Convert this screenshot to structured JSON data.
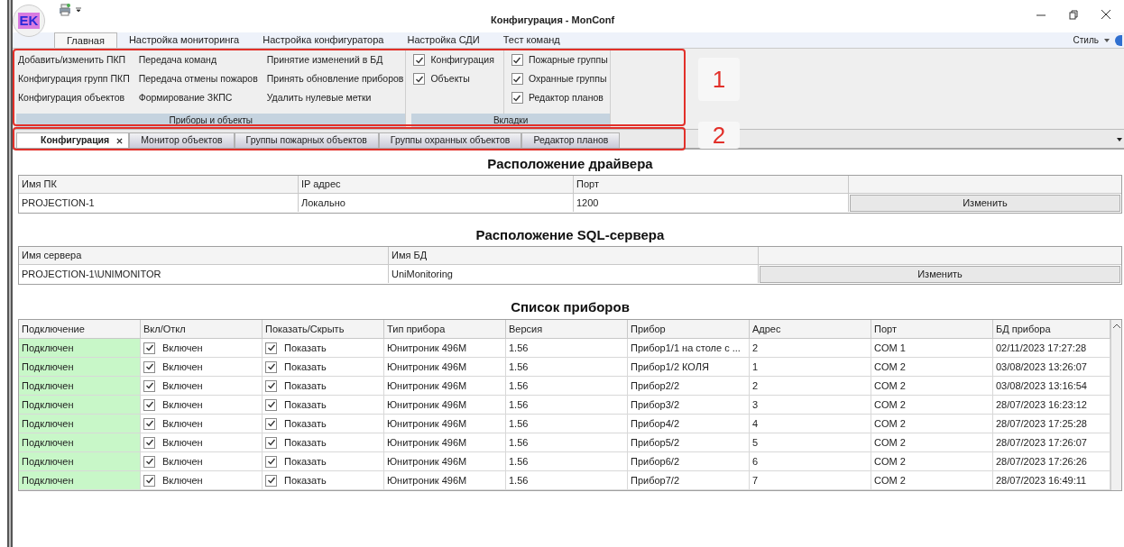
{
  "window": {
    "title": "Конфигурация - MonConf",
    "logo": "EK"
  },
  "ribbon_tabs": [
    {
      "label": "Главная",
      "selected": true
    },
    {
      "label": "Настройка мониторинга",
      "selected": false
    },
    {
      "label": "Настройка конфигуратора",
      "selected": false
    },
    {
      "label": "Настройка СДИ",
      "selected": false
    },
    {
      "label": "Тест команд",
      "selected": false
    }
  ],
  "style_menu": "Стиль",
  "ribbon_groups": [
    {
      "kind": "commands",
      "title": "Приборы и объекты",
      "columns": [
        [
          "Добавить/изменить ПКП",
          "Конфигурация групп ПКП",
          "Конфигурация объектов"
        ],
        [
          "Передача команд",
          "Передача отмены пожаров",
          "Формирование ЗКПС"
        ],
        [
          "Принятие изменений в БД",
          "Принять обновление приборов",
          "Удалить нулевые метки"
        ]
      ]
    },
    {
      "kind": "checks",
      "title": "Вкладки",
      "columns": [
        [
          {
            "label": "Конфигурация",
            "checked": true
          },
          {
            "label": "Объекты",
            "checked": true
          }
        ],
        [
          {
            "label": "Пожарные группы",
            "checked": true
          },
          {
            "label": "Охранные группы",
            "checked": true
          },
          {
            "label": "Редактор планов",
            "checked": true
          }
        ]
      ]
    }
  ],
  "doc_tabs": [
    {
      "label": "Конфигурация",
      "selected": true,
      "closable": true
    },
    {
      "label": "Монитор объектов",
      "selected": false,
      "closable": false
    },
    {
      "label": "Группы пожарных объектов",
      "selected": false,
      "closable": false
    },
    {
      "label": "Группы охранных объектов",
      "selected": false,
      "closable": false
    },
    {
      "label": "Редактор планов",
      "selected": false,
      "closable": false
    }
  ],
  "annotations": [
    {
      "label": "1"
    },
    {
      "label": "2"
    }
  ],
  "driver": {
    "title": "Расположение драйвера",
    "columns": [
      "Имя ПК",
      "IP адрес",
      "Порт"
    ],
    "row": [
      "PROJECTION-1",
      "Локально",
      "1200"
    ],
    "button": "Изменить"
  },
  "sql": {
    "title": "Расположение SQL-сервера",
    "columns": [
      "Имя сервера",
      "Имя БД"
    ],
    "row": [
      "PROJECTION-1\\UNIMONITOR",
      "UniMonitoring"
    ],
    "button": "Изменить"
  },
  "devices": {
    "title": "Список приборов",
    "columns": [
      "Подключение",
      "Вкл/Откл",
      "Показать/Скрыть",
      "Тип прибора",
      "Версия",
      "Прибор",
      "Адрес",
      "Порт",
      "БД прибора"
    ],
    "rows": [
      {
        "connection": "Подключен",
        "connected": true,
        "enabled": "Включен",
        "enabled_checked": true,
        "show": "Показать",
        "show_checked": true,
        "type": "Юнитроник 496М",
        "version": "1.56",
        "device": "Прибор1/1 на столе с ...",
        "address": "2",
        "port": "COM 1",
        "db": "02/11/2023 17:27:28"
      },
      {
        "connection": "Подключен",
        "connected": true,
        "enabled": "Включен",
        "enabled_checked": true,
        "show": "Показать",
        "show_checked": true,
        "type": "Юнитроник 496М",
        "version": "1.56",
        "device": "Прибор1/2 КОЛЯ",
        "address": "1",
        "port": "COM 2",
        "db": "03/08/2023 13:26:07"
      },
      {
        "connection": "Подключен",
        "connected": true,
        "enabled": "Включен",
        "enabled_checked": true,
        "show": "Показать",
        "show_checked": true,
        "type": "Юнитроник 496М",
        "version": "1.56",
        "device": "Прибор2/2",
        "address": "2",
        "port": "COM 2",
        "db": "03/08/2023 13:16:54"
      },
      {
        "connection": "Подключен",
        "connected": true,
        "enabled": "Включен",
        "enabled_checked": true,
        "show": "Показать",
        "show_checked": true,
        "type": "Юнитроник 496М",
        "version": "1.56",
        "device": "Прибор3/2",
        "address": "3",
        "port": "COM 2",
        "db": "28/07/2023 16:23:12"
      },
      {
        "connection": "Подключен",
        "connected": true,
        "enabled": "Включен",
        "enabled_checked": true,
        "show": "Показать",
        "show_checked": true,
        "type": "Юнитроник 496М",
        "version": "1.56",
        "device": "Прибор4/2",
        "address": "4",
        "port": "COM 2",
        "db": "28/07/2023 17:25:28"
      },
      {
        "connection": "Подключен",
        "connected": true,
        "enabled": "Включен",
        "enabled_checked": true,
        "show": "Показать",
        "show_checked": true,
        "type": "Юнитроник 496М",
        "version": "1.56",
        "device": "Прибор5/2",
        "address": "5",
        "port": "COM 2",
        "db": "28/07/2023 17:26:07"
      },
      {
        "connection": "Подключен",
        "connected": true,
        "enabled": "Включен",
        "enabled_checked": true,
        "show": "Показать",
        "show_checked": true,
        "type": "Юнитроник 496М",
        "version": "1.56",
        "device": "Прибор6/2",
        "address": "6",
        "port": "COM 2",
        "db": "28/07/2023 17:26:26"
      },
      {
        "connection": "Подключен",
        "connected": true,
        "enabled": "Включен",
        "enabled_checked": true,
        "show": "Показать",
        "show_checked": true,
        "type": "Юнитроник 496М",
        "version": "1.56",
        "device": "Прибор7/2",
        "address": "7",
        "port": "COM 2",
        "db": "28/07/2023 16:49:11"
      }
    ]
  }
}
